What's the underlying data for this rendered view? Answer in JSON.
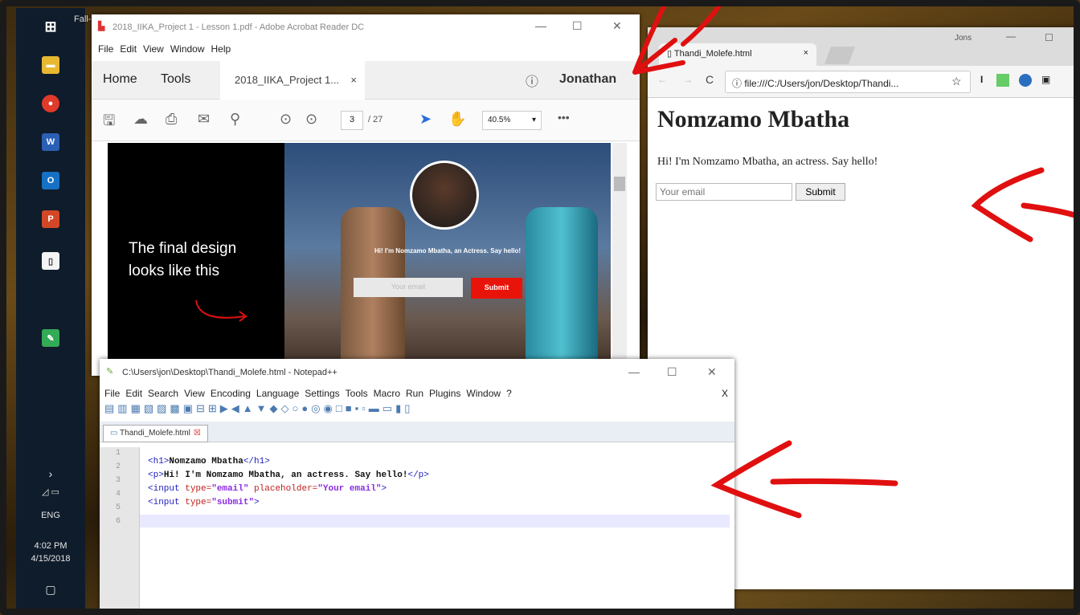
{
  "taskbar": {
    "start_label": "Start",
    "language": "ENG",
    "time": "4:02 PM",
    "date": "4/15/2018",
    "window_partial_title": "Fall-"
  },
  "acrobat": {
    "title": "2018_IIKA_Project 1 - Lesson 1.pdf - Adobe Acrobat Reader DC",
    "menu": [
      "File",
      "Edit",
      "View",
      "Window",
      "Help"
    ],
    "tab_home": "Home",
    "tab_tools": "Tools",
    "doc_tab": "2018_IIKA_Project 1...",
    "user": "Jonathan",
    "page_current": "3",
    "page_total": "/ 27",
    "zoom": "40.5%",
    "slide_heading_line1": "The final design",
    "slide_heading_line2": "looks like this",
    "slide_tagline": "Hi! I'm Nomzamo Mbatha, an Actress. Say hello!",
    "slide_email_placeholder": "Your email",
    "slide_submit": "Submit"
  },
  "chrome": {
    "tab_title": "Thandi_Molefe.html",
    "user": "Jons",
    "url": "file:///C:/Users/jon/Desktop/Thandi...",
    "heading": "Nomzamo Mbatha",
    "paragraph": "Hi! I'm Nomzamo Mbatha, an actress. Say hello!",
    "email_placeholder": "Your email",
    "submit": "Submit"
  },
  "notepad": {
    "title": "C:\\Users\\jon\\Desktop\\Thandi_Molefe.html - Notepad++",
    "menu": [
      "File",
      "Edit",
      "Search",
      "View",
      "Encoding",
      "Language",
      "Settings",
      "Tools",
      "Macro",
      "Run",
      "Plugins",
      "Window",
      "?"
    ],
    "file_tab": "Thandi_Molefe.html",
    "line_numbers": [
      "1",
      "2",
      "3",
      "4",
      "5",
      "6"
    ]
  },
  "colors": {
    "annotation_red": "#e01010",
    "submit_red": "#e8140a",
    "taskbar": "#0f1c2b"
  }
}
